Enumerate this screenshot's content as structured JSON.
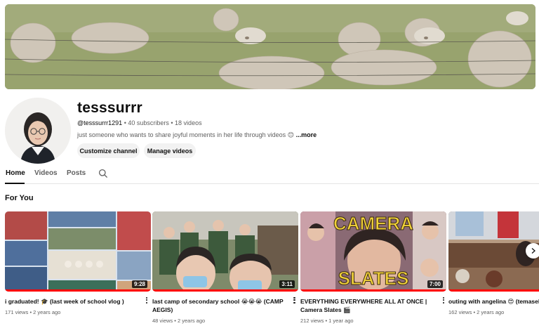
{
  "channel": {
    "name": "tesssurrr",
    "handle": "@tesssurrr1291",
    "subscribers": "40 subscribers",
    "video_count": "18 videos",
    "description": "just someone who wants to share joyful moments in her life through videos 😊",
    "more_label": "...more",
    "customize_label": "Customize channel",
    "manage_label": "Manage videos"
  },
  "tabs": [
    {
      "label": "Home",
      "active": true
    },
    {
      "label": "Videos",
      "active": false
    },
    {
      "label": "Posts",
      "active": false
    }
  ],
  "section_title": "For You",
  "videos": [
    {
      "title": "i graduated! 🎓 (last week of school vlog )",
      "views": "171 views",
      "age": "2 years ago",
      "duration": "9:28"
    },
    {
      "title": "last camp of secondary school 😭😭😭 (CAMP AEGIS)",
      "views": "48 views",
      "age": "2 years ago",
      "duration": "3:11"
    },
    {
      "title": "EVERYTHING EVERYWHERE ALL AT ONCE | Camera Slates 🎬",
      "views": "212 views",
      "age": "1 year ago",
      "duration": "7:00"
    },
    {
      "title": "outing with angelina 😍 (temasek",
      "views": "162 views",
      "age": "2 years ago",
      "duration": ""
    }
  ],
  "thumb_text": {
    "camera": "CAMERA",
    "slates": "SLATES"
  },
  "colors": {
    "accent": "#ff0000",
    "chip": "#f2f2f2",
    "muted": "#606060"
  }
}
